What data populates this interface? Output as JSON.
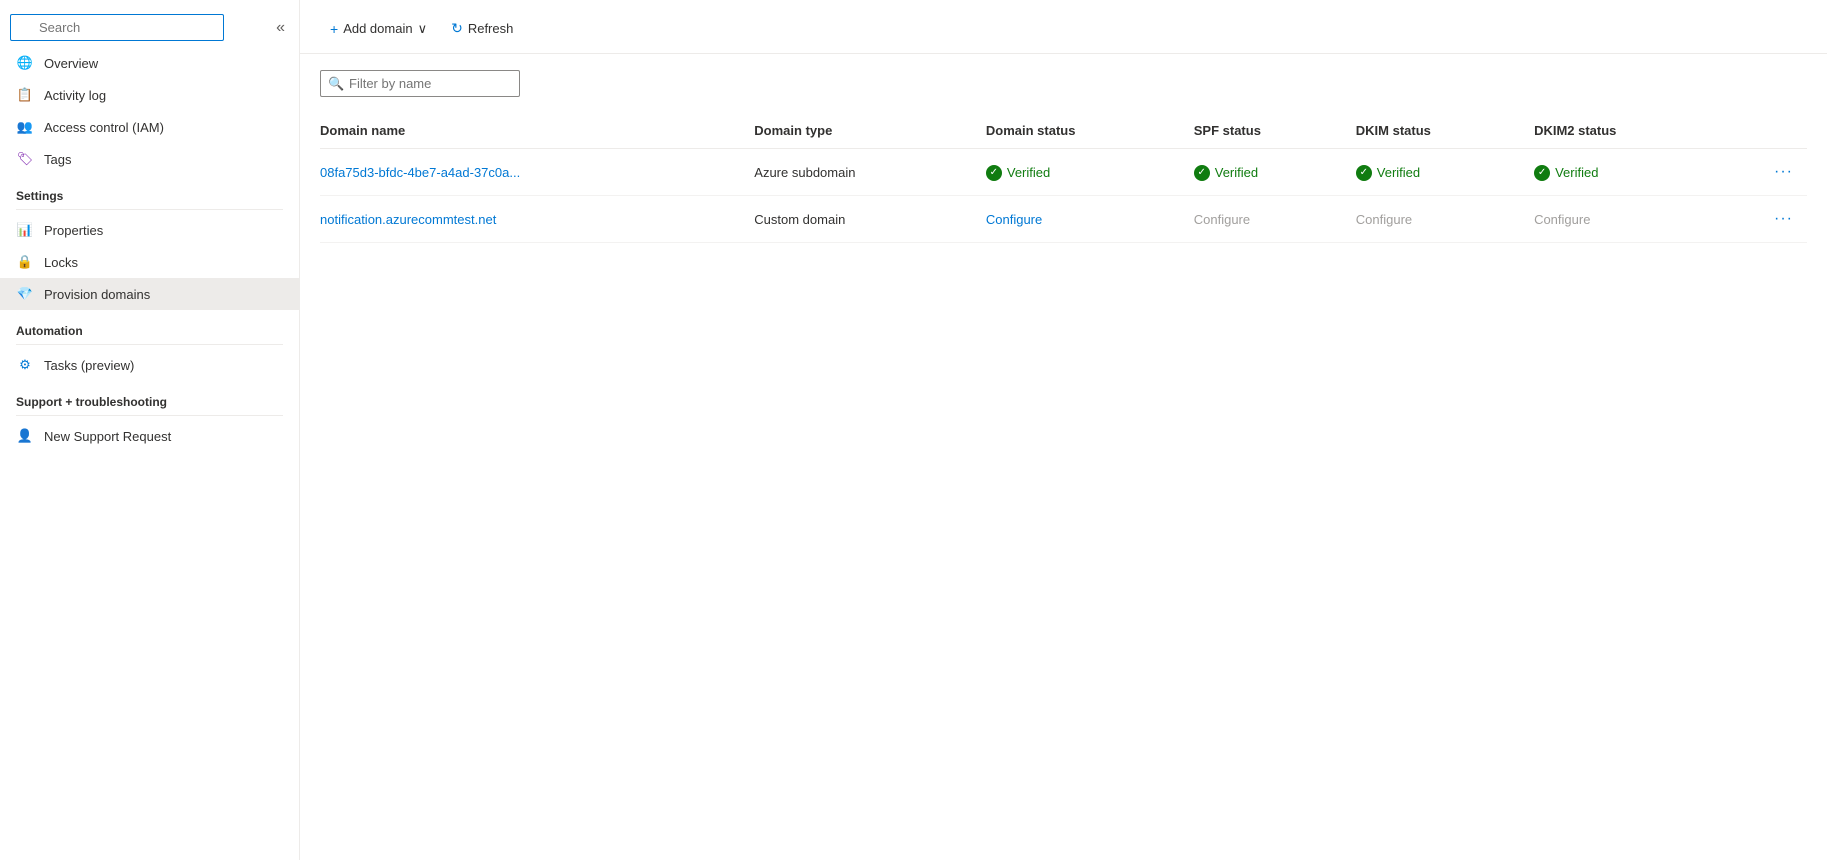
{
  "sidebar": {
    "search_placeholder": "Search",
    "collapse_icon": "«",
    "nav_items": [
      {
        "id": "overview",
        "label": "Overview",
        "icon": "🌐",
        "active": false
      },
      {
        "id": "activity-log",
        "label": "Activity log",
        "icon": "📋",
        "active": false
      },
      {
        "id": "access-control",
        "label": "Access control (IAM)",
        "icon": "👥",
        "active": false
      },
      {
        "id": "tags",
        "label": "Tags",
        "icon": "🏷",
        "active": false
      }
    ],
    "sections": [
      {
        "label": "Settings",
        "items": [
          {
            "id": "properties",
            "label": "Properties",
            "icon": "📊",
            "active": false
          },
          {
            "id": "locks",
            "label": "Locks",
            "icon": "🔒",
            "active": false
          },
          {
            "id": "provision-domains",
            "label": "Provision domains",
            "icon": "💎",
            "active": true
          }
        ]
      },
      {
        "label": "Automation",
        "items": [
          {
            "id": "tasks-preview",
            "label": "Tasks (preview)",
            "icon": "⚙",
            "active": false
          }
        ]
      },
      {
        "label": "Support + troubleshooting",
        "items": [
          {
            "id": "new-support-request",
            "label": "New Support Request",
            "icon": "👤",
            "active": false
          }
        ]
      }
    ]
  },
  "toolbar": {
    "add_domain_label": "Add domain",
    "add_domain_icon": "+",
    "dropdown_icon": "∨",
    "refresh_label": "Refresh",
    "refresh_icon": "↻"
  },
  "filter": {
    "placeholder": "Filter by name"
  },
  "table": {
    "columns": [
      "Domain name",
      "Domain type",
      "Domain status",
      "SPF status",
      "DKIM status",
      "DKIM2 status"
    ],
    "rows": [
      {
        "domain_name": "08fa75d3-bfdc-4be7-a4ad-37c0a...",
        "domain_type": "Azure subdomain",
        "domain_status": "Verified",
        "domain_status_type": "verified",
        "spf_status": "Verified",
        "spf_status_type": "verified",
        "dkim_status": "Verified",
        "dkim_status_type": "verified",
        "dkim2_status": "Verified",
        "dkim2_status_type": "verified"
      },
      {
        "domain_name": "notification.azurecommtest.net",
        "domain_type": "Custom domain",
        "domain_status": "Configure",
        "domain_status_type": "configure-active",
        "spf_status": "Configure",
        "spf_status_type": "configure-inactive",
        "dkim_status": "Configure",
        "dkim_status_type": "configure-inactive",
        "dkim2_status": "Configure",
        "dkim2_status_type": "configure-inactive"
      }
    ]
  }
}
